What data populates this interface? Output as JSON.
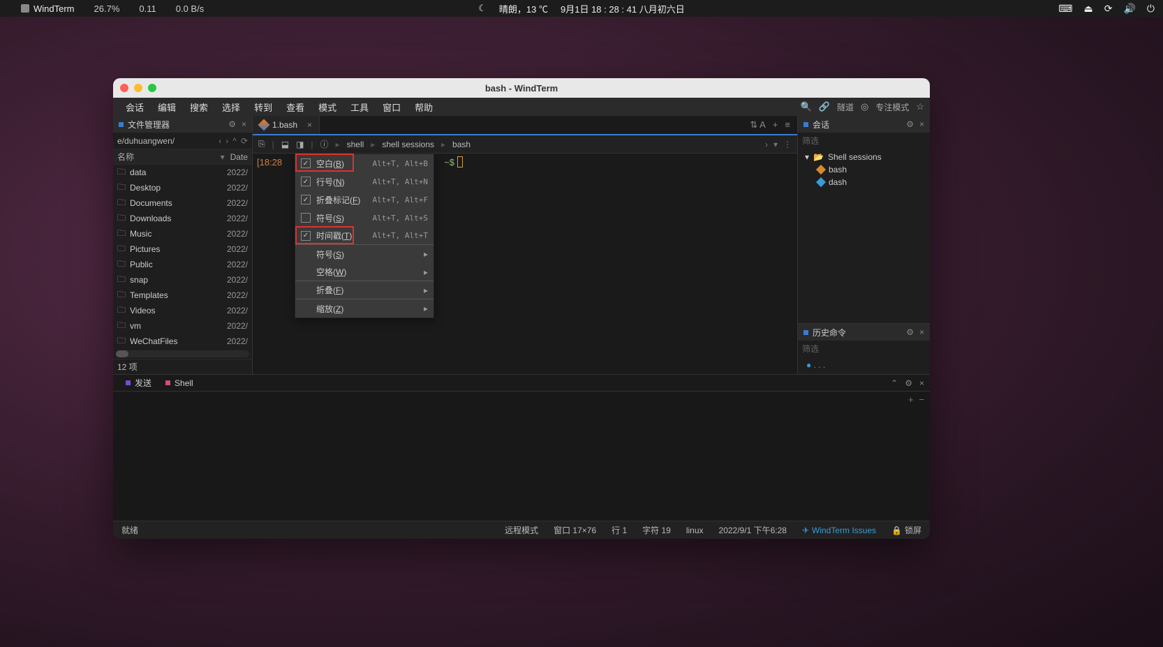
{
  "menubar": {
    "app_name": "WindTerm",
    "cpu": "26.7%",
    "mem": "0.11",
    "net": "0.0 B/s",
    "weather": "晴朗，13 ℃",
    "datetime": "9月1日  18 : 28 : 41  八月初六日"
  },
  "window": {
    "title": "bash - WindTerm"
  },
  "app_menu": {
    "items": [
      "会话",
      "编辑",
      "搜索",
      "选择",
      "转到",
      "查看",
      "模式",
      "工具",
      "窗口",
      "帮助"
    ],
    "right": {
      "tunnel": "隧道",
      "focus_mode": "专注模式"
    }
  },
  "file_manager": {
    "title": "文件管理器",
    "path": "e/duhuangwen/",
    "col_name": "名称",
    "col_date": "Date",
    "items": [
      {
        "name": "data",
        "date": "2022/"
      },
      {
        "name": "Desktop",
        "date": "2022/"
      },
      {
        "name": "Documents",
        "date": "2022/"
      },
      {
        "name": "Downloads",
        "date": "2022/"
      },
      {
        "name": "Music",
        "date": "2022/"
      },
      {
        "name": "Pictures",
        "date": "2022/"
      },
      {
        "name": "Public",
        "date": "2022/"
      },
      {
        "name": "snap",
        "date": "2022/"
      },
      {
        "name": "Templates",
        "date": "2022/"
      },
      {
        "name": "Videos",
        "date": "2022/"
      },
      {
        "name": "vm",
        "date": "2022/"
      },
      {
        "name": "WeChatFiles",
        "date": "2022/"
      }
    ],
    "footer": "12 项"
  },
  "tab": {
    "label": "1.bash"
  },
  "breadcrumb": {
    "a": "shell",
    "b": "shell sessions",
    "c": "bash"
  },
  "terminal": {
    "time": "[18:28",
    "prompt": "~$"
  },
  "dropdown": {
    "items": [
      {
        "checked": true,
        "label_pre": "空白(",
        "key": "B",
        "label_post": ")",
        "shortcut": "Alt+T, Alt+B",
        "highlight": true
      },
      {
        "checked": true,
        "label_pre": "行号(",
        "key": "N",
        "label_post": ")",
        "shortcut": "Alt+T, Alt+N"
      },
      {
        "checked": true,
        "label_pre": "折叠标记(",
        "key": "F",
        "label_post": ")",
        "shortcut": "Alt+T, Alt+F"
      },
      {
        "checked": false,
        "label_pre": "符号(",
        "key": "S",
        "label_post": ")",
        "shortcut": "Alt+T, Alt+S"
      },
      {
        "checked": true,
        "label_pre": "时间戳(",
        "key": "T",
        "label_post": ")",
        "shortcut": "Alt+T, Alt+T",
        "highlight": true,
        "sep_after": true
      },
      {
        "label_pre": "符号(",
        "key": "S",
        "label_post": ")",
        "submenu": true
      },
      {
        "label_pre": "空格(",
        "key": "W",
        "label_post": ")",
        "submenu": true,
        "sep_after": true
      },
      {
        "label_pre": "折叠(",
        "key": "F",
        "label_post": ")",
        "submenu": true,
        "sep_after": true
      },
      {
        "label_pre": "缩放(",
        "key": "Z",
        "label_post": ")",
        "submenu": true
      }
    ]
  },
  "sessions": {
    "title": "会话",
    "filter": "筛选",
    "group": "Shell sessions",
    "items": [
      {
        "name": "bash",
        "color": "#d48b2a"
      },
      {
        "name": "dash",
        "color": "#3a9bd5"
      }
    ]
  },
  "history": {
    "title": "历史命令",
    "filter": "筛选",
    "item": ". . ."
  },
  "bottom_tabs": {
    "send": "发送",
    "shell": "Shell"
  },
  "statusbar": {
    "ready": "就绪",
    "remote": "远程模式",
    "window": "窗口  17×76",
    "line": "行  1",
    "char": "字符  19",
    "os": "linux",
    "time": "2022/9/1  下午6:28",
    "issues": "WindTerm Issues",
    "lock": "锁屏"
  }
}
